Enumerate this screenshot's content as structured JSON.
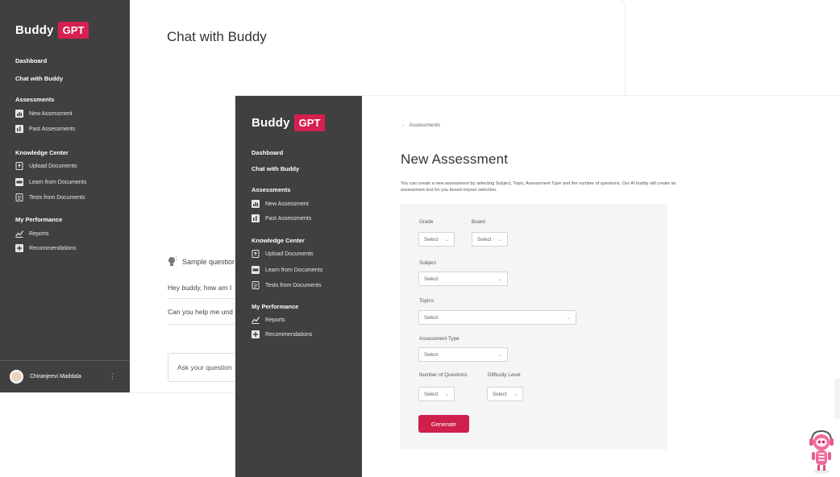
{
  "brand": {
    "name": "Buddy",
    "badge": "GPT",
    "accent": "#d6204f",
    "sidebar_bg": "#404040"
  },
  "back_window": {
    "sidebar": {
      "dashboard": "Dashboard",
      "chat": "Chat with Buddy",
      "assessments_head": "Assessments",
      "new_assessment": "New Assessment",
      "past_assessments": "Past Assessments",
      "knowledge_head": "Knowledge Center",
      "upload_documents": "Upload Documents",
      "learn_documents": "Learn from Documents",
      "tests_documents": "Tests from Documents",
      "performance_head": "My Performance",
      "reports": "Reports",
      "recommendations": "Recommendations"
    },
    "user": {
      "name": "Chiranjeevi Maddala"
    },
    "main": {
      "title": "Chat with Buddy",
      "sample_label": "Sample question",
      "questions": [
        "Hey buddy, how am I",
        "Can you help me und"
      ],
      "ask_placeholder": "Ask your question"
    }
  },
  "front_window": {
    "sidebar": {
      "dashboard": "Dashboard",
      "chat": "Chat with Buddy",
      "assessments_head": "Assessments",
      "new_assessment": "New Assessment",
      "past_assessments": "Past Assessments",
      "knowledge_head": "Knowledge Center",
      "upload_documents": "Upload Documents",
      "learn_documents": "Learn from Documents",
      "tests_documents": "Tests from Documents",
      "performance_head": "My Performance",
      "reports": "Reports",
      "recommendations": "Recommendations"
    },
    "breadcrumb": "Assessments",
    "title": "New Assessment",
    "description": "You can create a new assessment by selecting Subject, Topic, Assessment Type and the number of questions. Our AI buddy will create an assessment test for you besed onyour selection.",
    "form": {
      "grade_label": "Grade",
      "board_label": "Board",
      "subject_label": "Subject",
      "topics_label": "Topics",
      "assessment_type_label": "Assessment Type",
      "num_questions_label": "Number of Questions",
      "difficulty_label": "Difficulty Level",
      "grade_value": "Select",
      "board_value": "Select",
      "subject_value": "Select",
      "topics_value": "Select",
      "assessment_type_value": "Select",
      "num_questions_value": "Select",
      "difficulty_value": "Select",
      "generate_label": "Generate"
    }
  }
}
